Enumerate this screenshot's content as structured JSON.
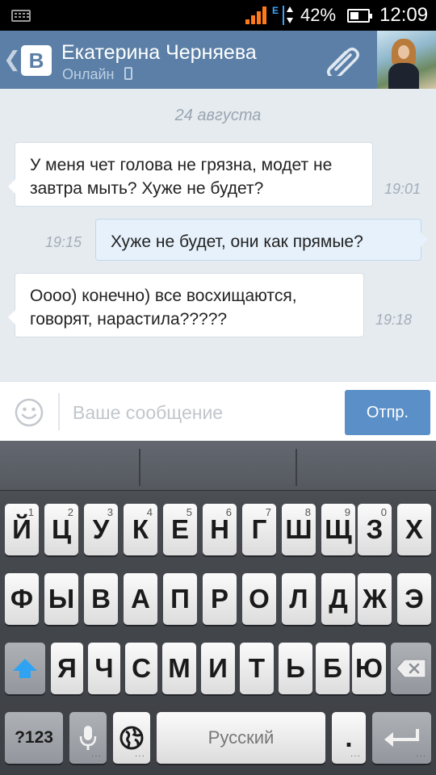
{
  "status_bar": {
    "battery_percent": "42%",
    "battery_level": 0.42,
    "time": "12:09"
  },
  "header": {
    "contact_name": "Екатерина Черняева",
    "online_status": "Онлайн",
    "colors": {
      "background": "#5b7fa6"
    }
  },
  "chat": {
    "date_separator": "24 августа",
    "messages": [
      {
        "direction": "in",
        "text": "У меня чет голова не грязна, модет не завтра мыть? Хуже не будет?",
        "time": "19:01"
      },
      {
        "direction": "out",
        "text": "Хуже не будет, они как прямые?",
        "time": "19:15"
      },
      {
        "direction": "in",
        "text": "Оооо) конечно) все восхищаются, говорят, нарастила?????",
        "time": "19:18"
      }
    ]
  },
  "composer": {
    "placeholder": "Ваше сообщение",
    "value": "",
    "send_label": "Отпр.",
    "colors": {
      "send_button": "#5b8fc7"
    }
  },
  "keyboard": {
    "row1": [
      {
        "label": "Й",
        "num": "1"
      },
      {
        "label": "Ц",
        "num": "2"
      },
      {
        "label": "У",
        "num": "3"
      },
      {
        "label": "К",
        "num": "4"
      },
      {
        "label": "Е",
        "num": "5"
      },
      {
        "label": "Н",
        "num": "6"
      },
      {
        "label": "Г",
        "num": "7"
      },
      {
        "label": "Ш",
        "num": "8"
      },
      {
        "label": "Щ",
        "num": "9"
      },
      {
        "label": "З",
        "num": "0"
      },
      {
        "label": "Х",
        "num": ""
      }
    ],
    "row2": [
      "Ф",
      "Ы",
      "В",
      "А",
      "П",
      "Р",
      "О",
      "Л",
      "Д",
      "Ж",
      "Э"
    ],
    "row3": [
      "Я",
      "Ч",
      "С",
      "М",
      "И",
      "Т",
      "Ь",
      "Б",
      "Ю"
    ],
    "symbols_label": "?123",
    "space_label": "Русский",
    "period_label": ".",
    "icons": [
      "shift-icon",
      "backspace-icon",
      "mic-icon",
      "globe-icon",
      "enter-icon"
    ]
  }
}
